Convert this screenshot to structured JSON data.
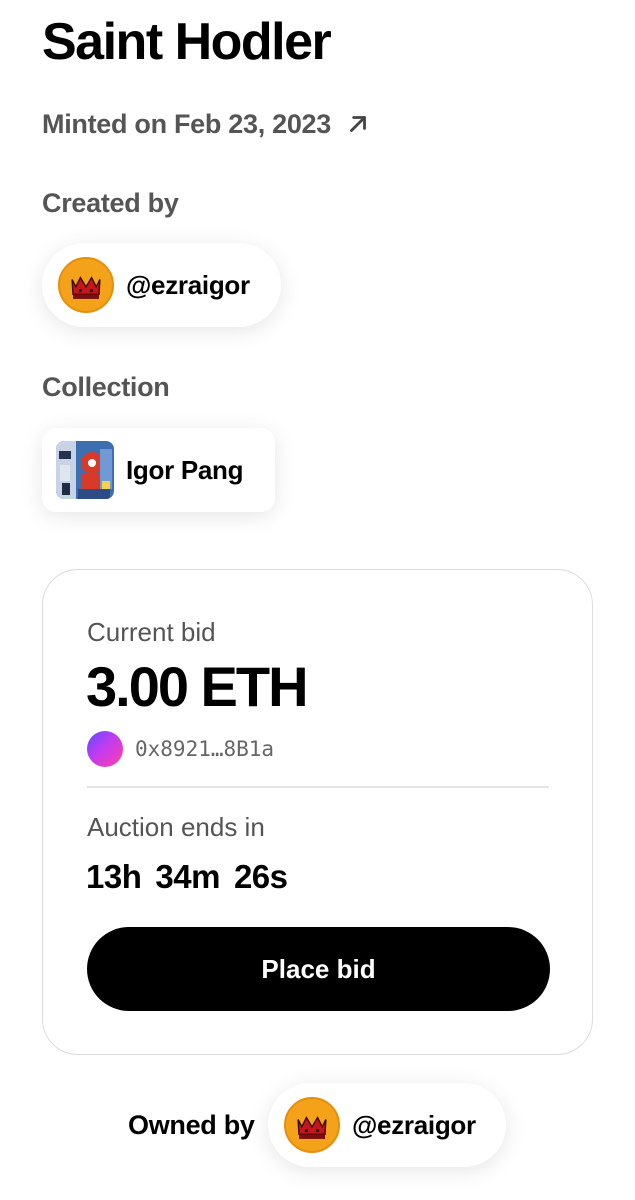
{
  "nft": {
    "title": "Saint Hodler",
    "minted_text": "Minted on Feb 23, 2023"
  },
  "creator": {
    "label": "Created by",
    "handle": "@ezraigor"
  },
  "collection": {
    "label": "Collection",
    "name": "Igor Pang"
  },
  "auction": {
    "bid_label": "Current bid",
    "bid_amount": "3.00 ETH",
    "bidder_address": "0x8921…8B1a",
    "ends_label": "Auction ends in",
    "hours": "13h",
    "minutes": "34m",
    "seconds": "26s",
    "place_bid_label": "Place bid"
  },
  "owner": {
    "label": "Owned by",
    "handle": "@ezraigor"
  },
  "icons": {
    "minted_link": "arrow-up-right-icon",
    "avatar": "crown-avatar-icon"
  },
  "colors": {
    "avatar_bg": "#f3a21a",
    "button_bg": "#000000",
    "muted_text": "#555555"
  }
}
